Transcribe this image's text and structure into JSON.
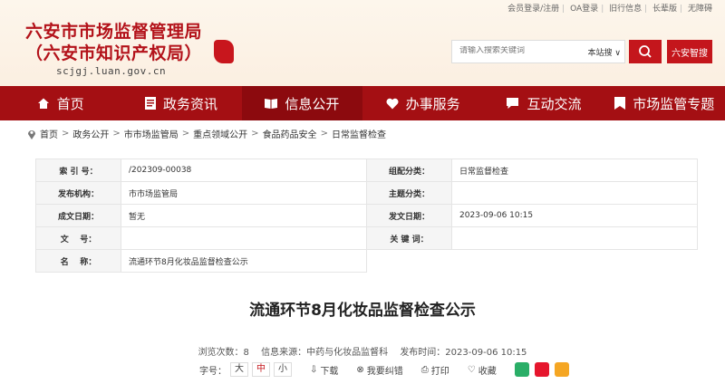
{
  "toplinks": [
    "会员登录/注册",
    "OA登录",
    "旧行信息",
    "长辈版",
    "无障碍"
  ],
  "site": {
    "name_line1": "六安市市场监督管理局",
    "name_line2": "（六安市知识产权局）",
    "domain": "scjgj.luan.gov.cn"
  },
  "search": {
    "placeholder": "请输入搜索关键词",
    "scope": "本站搜 ∨",
    "smart_label": "六安智搜"
  },
  "nav": [
    {
      "label": "首页",
      "icon": "home-icon"
    },
    {
      "label": "政务资讯",
      "icon": "document-icon"
    },
    {
      "label": "信息公开",
      "icon": "book-icon"
    },
    {
      "label": "办事服务",
      "icon": "heart-icon"
    },
    {
      "label": "互动交流",
      "icon": "chat-icon"
    },
    {
      "label": "市场监管专题",
      "icon": "bookmark-icon"
    }
  ],
  "breadcrumb": [
    "首页",
    "政务公开",
    "市市场监管局",
    "重点领域公开",
    "食品药品安全",
    "日常监督检查"
  ],
  "info": {
    "index_label": "索 引 号：",
    "index_value": "/202309-00038",
    "group_label": "组配分类：",
    "group_value": "日常监督检查",
    "org_label": "发布机构：",
    "org_value": "市市场监管局",
    "topic_label": "主题分类：",
    "topic_value": "",
    "date_label": "成文日期：",
    "date_value": "暂无",
    "pub_label": "发文日期：",
    "pub_value": "2023-09-06 10:15",
    "doc_label": "文    号：",
    "doc_value": "",
    "kw_label": "关 键 词：",
    "kw_value": "",
    "name_label": "名    称：",
    "name_value": "流通环节8月化妆品监督检查公示"
  },
  "article": {
    "title": "流通环节8月化妆品监督检查公示",
    "views": "浏览次数：8",
    "source": "信息来源：中药与化妆品监督科",
    "time": "发布时间：2023-09-06 10:15"
  },
  "tools": {
    "fontsize_label": "字号：",
    "large": "大",
    "medium": "中",
    "small": "小",
    "download": "下载",
    "correct": "我要纠错",
    "print": "打印",
    "favorite": "收藏"
  }
}
